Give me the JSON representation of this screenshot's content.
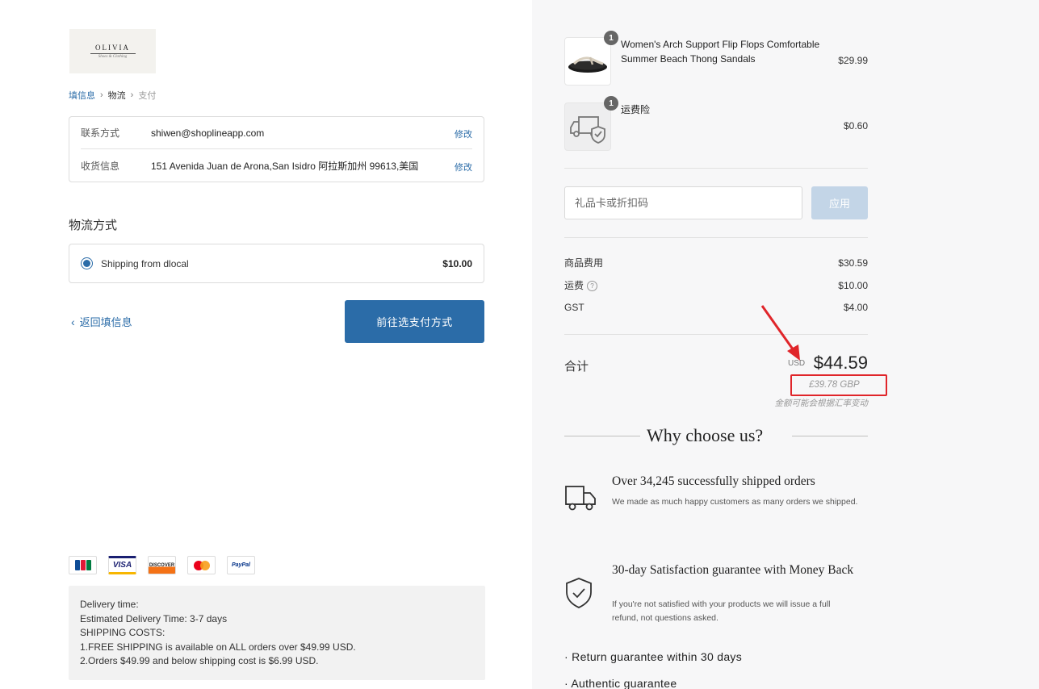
{
  "brand": {
    "logo_text": "OLIVIA",
    "logo_tagline": "Shoes & Clothing"
  },
  "breadcrumb": {
    "step1": "填信息",
    "step2": "物流",
    "step3": "支付"
  },
  "contact": {
    "contact_label": "联系方式",
    "contact_value": "shiwen@shoplineapp.com",
    "address_label": "收货信息",
    "address_value": "151 Avenida Juan de Arona,San Isidro 阿拉斯加州 99613,美国",
    "edit_label": "修改"
  },
  "shipping": {
    "title": "物流方式",
    "option_name": "Shipping from dlocal",
    "option_price": "$10.00"
  },
  "actions": {
    "back_label": "返回填信息",
    "continue_label": "前往选支付方式"
  },
  "payments": [
    "JCB",
    "VISA",
    "DISCOVER",
    "Mastercard",
    "PayPal"
  ],
  "notice": {
    "lines": [
      "Delivery time:",
      "Estimated Delivery Time: 3-7 days",
      "SHIPPING COSTS:",
      "1.FREE SHIPPING is available on ALL orders over $49.99 USD.",
      "2.Orders $49.99 and below shipping cost is $6.99 USD."
    ]
  },
  "cart": {
    "items": [
      {
        "qty": "1",
        "name": "Women's Arch Support Flip Flops Comfortable Summer Beach Thong Sandals",
        "price": "$29.99"
      },
      {
        "qty": "1",
        "name": "运费险",
        "price": "$0.60"
      }
    ]
  },
  "coupon": {
    "placeholder": "礼品卡或折扣码",
    "apply_label": "应用"
  },
  "summary": {
    "subtotal_label": "商品费用",
    "subtotal_value": "$30.59",
    "shipping_label": "运费",
    "shipping_value": "$10.00",
    "tax_label": "GST",
    "tax_value": "$4.00",
    "total_label": "合计",
    "total_currency": "USD",
    "total_value": "$44.59",
    "converted_value": "£39.78 GBP",
    "rate_note": "金额可能会根据汇率变动"
  },
  "why": {
    "title": "Why choose us?",
    "features": [
      {
        "icon": "truck-icon",
        "title": "Over 34,245 successfully shipped orders",
        "desc": "We made as much happy customers as many orders we shipped."
      },
      {
        "icon": "shield-check-icon",
        "title": "30-day Satisfaction guarantee with Money Back",
        "desc": "If you're not satisfied with your products we will issue a full refund, not questions asked."
      }
    ],
    "bullets": [
      "Return guarantee within 30 days",
      "Authentic guarantee"
    ]
  },
  "colors": {
    "accent": "#2b6ca8",
    "highlight": "#e0252a",
    "panel": "#f7f7f8"
  }
}
